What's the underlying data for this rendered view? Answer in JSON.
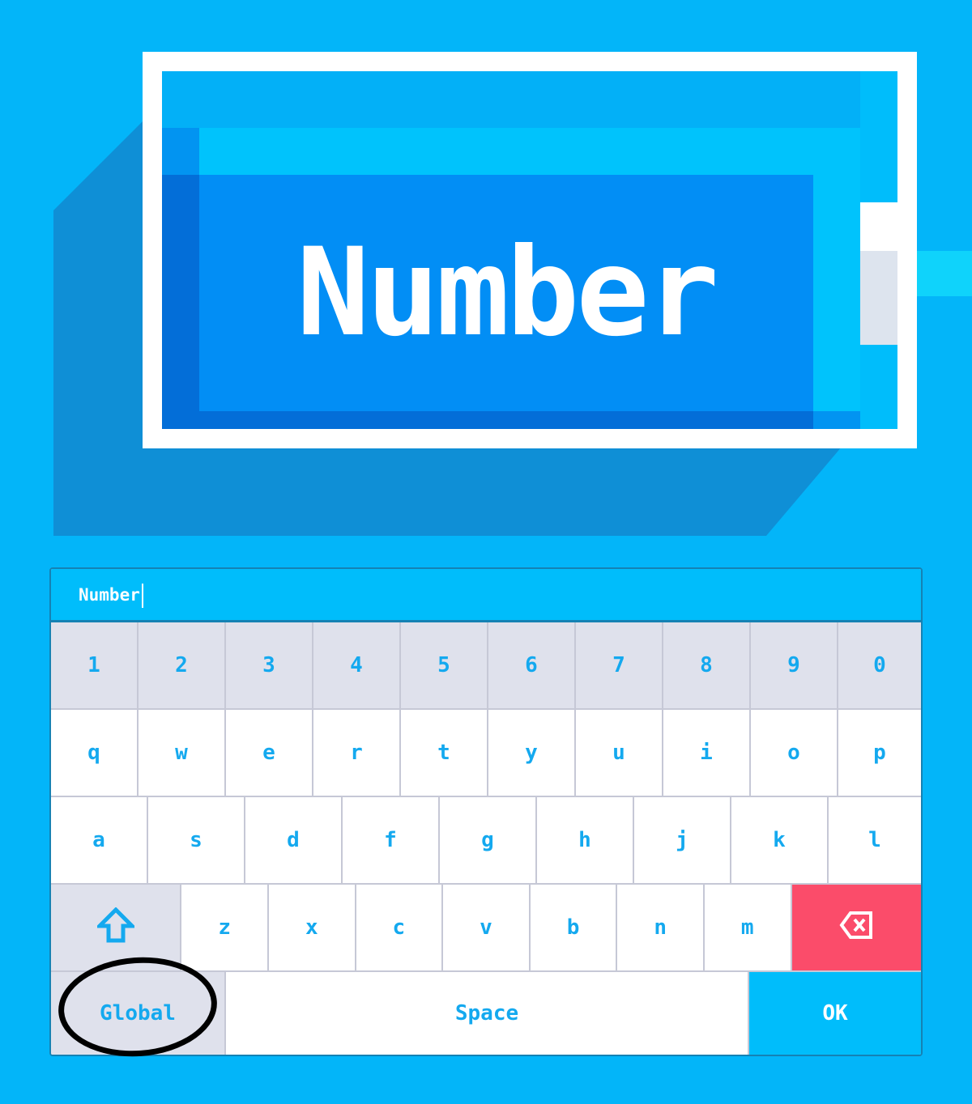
{
  "title_card": {
    "text": "Number"
  },
  "input": {
    "value": "Number"
  },
  "keyboard": {
    "number_row": [
      "1",
      "2",
      "3",
      "4",
      "5",
      "6",
      "7",
      "8",
      "9",
      "0"
    ],
    "row1": [
      "q",
      "w",
      "e",
      "r",
      "t",
      "y",
      "u",
      "i",
      "o",
      "p"
    ],
    "row2": [
      "a",
      "s",
      "d",
      "f",
      "g",
      "h",
      "j",
      "k",
      "l"
    ],
    "row3": [
      "z",
      "x",
      "c",
      "v",
      "b",
      "n",
      "m"
    ],
    "shift_icon": "shift-arrow-icon",
    "backspace_icon": "backspace-icon",
    "global_label": "Global",
    "space_label": "Space",
    "ok_label": "OK"
  },
  "colors": {
    "background": "#03b5f9",
    "key_text": "#14a9ef",
    "backspace": "#fb4c6a",
    "ok": "#00bdfb",
    "annotation_ring": "#000000"
  }
}
